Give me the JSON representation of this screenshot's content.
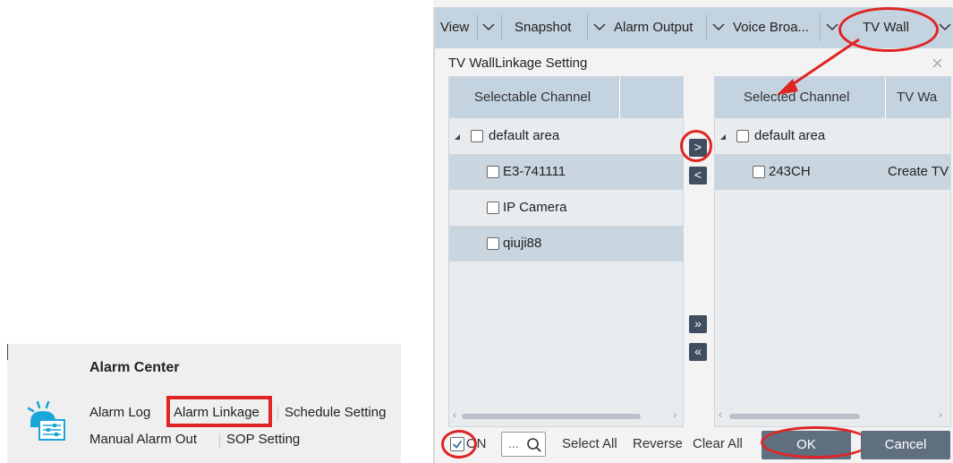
{
  "alarm_center": {
    "title": "Alarm Center",
    "links": [
      "Alarm Log",
      "Alarm Linkage",
      "Schedule Setting",
      "Manual Alarm Out",
      "SOP Setting"
    ]
  },
  "tabs": [
    "View",
    "Snapshot",
    "Alarm Output",
    "Voice Broa...",
    "TV Wall"
  ],
  "dialog": {
    "title": "TV WallLinkage Setting",
    "close": "×"
  },
  "selectable": {
    "header": "Selectable Channel",
    "group": "default area",
    "items": [
      "E3-741111",
      "IP Camera",
      "qiuji88"
    ]
  },
  "selected": {
    "header": "Selected Channel",
    "header2": "TV Wa",
    "group": "default area",
    "items": [
      {
        "name": "243CH",
        "tv": "Create TV"
      }
    ]
  },
  "move_buttons": {
    "add": ">",
    "remove": "<",
    "add_all": "»",
    "remove_all": "«"
  },
  "footer": {
    "on_label": "ON",
    "search_placeholder": "...",
    "select_all": "Select All",
    "reverse": "Reverse",
    "clear_all": "Clear All",
    "ok": "OK",
    "cancel": "Cancel"
  },
  "colors": {
    "accent": "#c4d3e0",
    "highlight": "#e02424",
    "button": "#5f6f7f"
  }
}
